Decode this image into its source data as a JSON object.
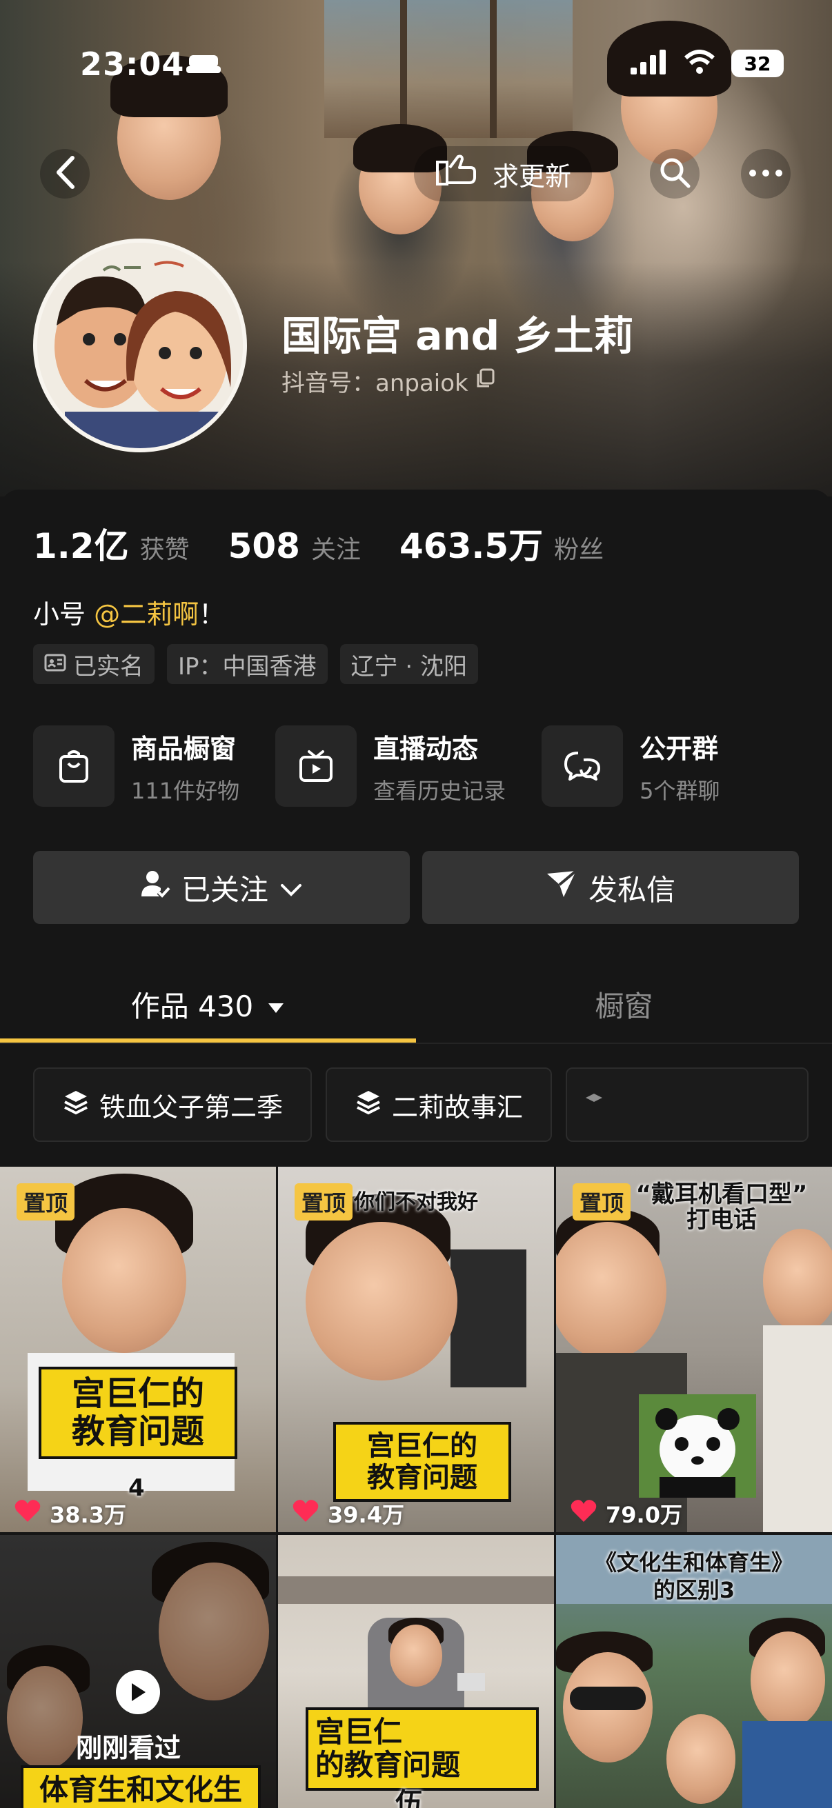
{
  "status_bar": {
    "time": "23:04",
    "battery": "32"
  },
  "header": {
    "update_label": "求更新"
  },
  "profile": {
    "name": "国际宫 and 乡土莉",
    "douyin_id": "抖音号：anpaiok"
  },
  "stats": [
    {
      "value": "1.2亿",
      "label": "获赞"
    },
    {
      "value": "508",
      "label": "关注"
    },
    {
      "value": "463.5万",
      "label": "粉丝"
    }
  ],
  "bio": {
    "prefix": "小号 ",
    "mention": "@二莉啊",
    "suffix": "！"
  },
  "tags": {
    "verified": "已实名",
    "ip": "IP：中国香港",
    "location": "辽宁 · 沈阳"
  },
  "services": [
    {
      "title": "商品橱窗",
      "subtitle": "111件好物",
      "icon": "bag-icon"
    },
    {
      "title": "直播动态",
      "subtitle": "查看历史记录",
      "icon": "tv-icon"
    },
    {
      "title": "公开群",
      "subtitle": "5个群聊",
      "icon": "chat-icon"
    }
  ],
  "actions": {
    "follow": "已关注",
    "message": "发私信"
  },
  "tabs": {
    "works": "作品 430",
    "showcase": "橱窗"
  },
  "collections": [
    "铁血父子第二季",
    "二莉故事汇"
  ],
  "colors": {
    "accent": "#f5c542",
    "like": "#fe2c55",
    "background": "#161616"
  },
  "videos": [
    {
      "pinned": "置顶",
      "caption": "宫巨仁的\n教育问题",
      "episode": "4",
      "likes": "38.3万"
    },
    {
      "pinned": "置顶",
      "top_text": "你们不对我好",
      "caption": "宫巨仁的\n教育问题",
      "likes": "39.4万"
    },
    {
      "pinned": "置顶",
      "top_text": "“戴耳机看口型”\n打电话",
      "likes": "79.0万"
    },
    {
      "watched": "刚刚看过",
      "caption": "体育生和文化生"
    },
    {
      "caption": "宫巨仁\n的教育问题",
      "bottom_text": "伍"
    },
    {
      "top_text": "《文化生和体育生》\n的区别3"
    }
  ]
}
